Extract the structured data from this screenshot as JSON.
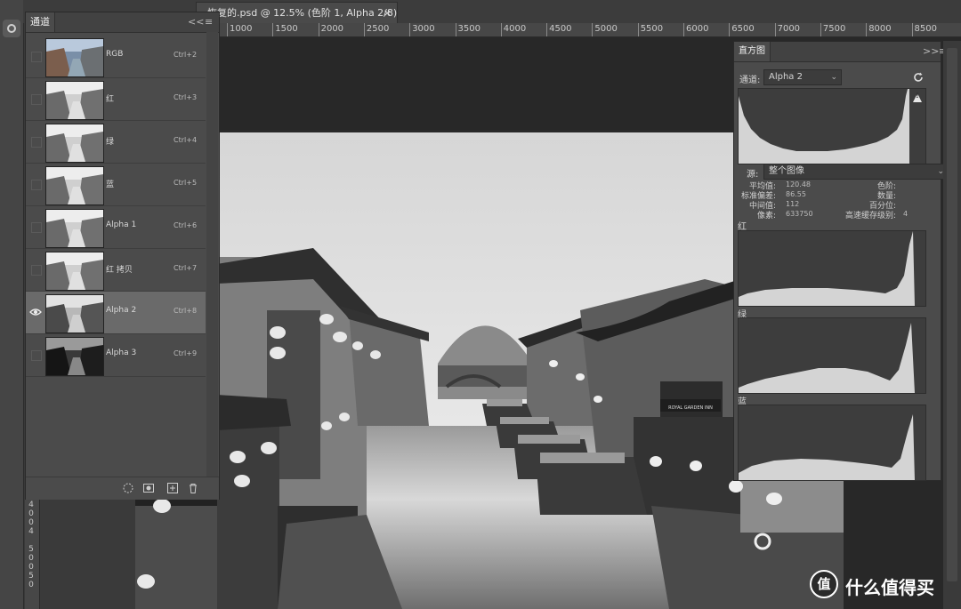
{
  "document": {
    "tab_title": "恢复的.psd @ 12.5% (色阶 1, Alpha 2/8) *",
    "close_glyph": "×",
    "ruler_marks": [
      "1000",
      "1500",
      "2000",
      "2500",
      "3000",
      "3500",
      "4000",
      "4500",
      "5000",
      "5500",
      "6000",
      "6500",
      "7000",
      "7500",
      "8000",
      "8500"
    ],
    "left_ruler_marks": [
      "4",
      "0",
      "0",
      "4",
      "5",
      "0",
      "0",
      "5",
      "0"
    ]
  },
  "channels_panel": {
    "tab_label": "通道",
    "collapse_glyph": "<<",
    "menu_glyph": "≡",
    "channels": [
      {
        "name": "RGB",
        "shortcut": "Ctrl+2",
        "visible": false,
        "selected": false,
        "tone": "color"
      },
      {
        "name": "红",
        "shortcut": "Ctrl+3",
        "visible": false,
        "selected": false,
        "tone": "light"
      },
      {
        "name": "绿",
        "shortcut": "Ctrl+4",
        "visible": false,
        "selected": false,
        "tone": "light"
      },
      {
        "name": "蓝",
        "shortcut": "Ctrl+5",
        "visible": false,
        "selected": false,
        "tone": "light"
      },
      {
        "name": "Alpha 1",
        "shortcut": "Ctrl+6",
        "visible": false,
        "selected": false,
        "tone": "light"
      },
      {
        "name": "红 拷贝",
        "shortcut": "Ctrl+7",
        "visible": false,
        "selected": false,
        "tone": "light"
      },
      {
        "name": "Alpha 2",
        "shortcut": "Ctrl+8",
        "visible": true,
        "selected": true,
        "tone": "mid"
      },
      {
        "name": "Alpha 3",
        "shortcut": "Ctrl+9",
        "visible": false,
        "selected": false,
        "tone": "dark"
      }
    ],
    "footer_icons": [
      "load-selection-icon",
      "save-selection-icon",
      "new-channel-icon",
      "delete-channel-icon"
    ]
  },
  "histogram_panel": {
    "tab_label": "直方图",
    "expand_glyph": ">>",
    "menu_glyph": "≡",
    "channel_label": "通道:",
    "channel_value": "Alpha 2",
    "warning_glyph": "!",
    "source_label": "源:",
    "source_value": "整个图像",
    "stats": {
      "mean_label": "平均值:",
      "mean": "120.48",
      "stddev_label": "标准偏差:",
      "stddev": "86.55",
      "median_label": "中间值:",
      "median": "112",
      "pixels_label": "像素:",
      "pixels": "633750",
      "level_label": "色阶:",
      "level": "",
      "count_label": "数量:",
      "count": "",
      "percentile_label": "百分位:",
      "percentile": "",
      "cache_label": "高速缓存级别:",
      "cache": "4"
    },
    "sub_histograms": [
      {
        "label": "红"
      },
      {
        "label": "绿"
      },
      {
        "label": "蓝"
      }
    ]
  },
  "watermark": {
    "logo_glyph": "值",
    "text": "什么值得买"
  },
  "photo": {
    "sign_text": "ROYAL GARDEN INN"
  }
}
